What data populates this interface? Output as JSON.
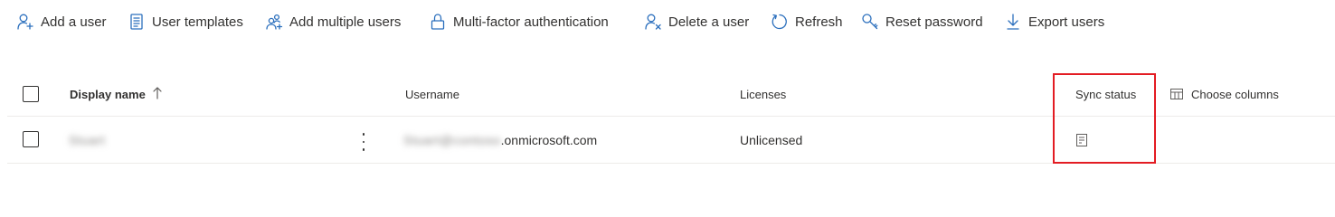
{
  "toolbar": {
    "items": [
      {
        "label": "Add a user",
        "icon": "person-add-icon"
      },
      {
        "label": "User templates",
        "icon": "document-list-icon"
      },
      {
        "label": "Add multiple users",
        "icon": "people-add-icon"
      },
      {
        "label": "Multi-factor authentication",
        "icon": "lock-icon"
      },
      {
        "label": "Delete a user",
        "icon": "person-delete-icon"
      },
      {
        "label": "Refresh",
        "icon": "refresh-icon"
      },
      {
        "label": "Reset password",
        "icon": "key-icon"
      },
      {
        "label": "Export users",
        "icon": "download-icon"
      }
    ]
  },
  "table": {
    "columns": {
      "display_name": "Display name",
      "username": "Username",
      "licenses": "Licenses",
      "sync_status": "Sync status",
      "choose_columns": "Choose columns"
    },
    "sort": {
      "column": "display_name",
      "direction": "ascending"
    },
    "rows": [
      {
        "display_name": "Stuart",
        "username_prefix": "Stuart@contoso",
        "username_domain": ".onmicrosoft.com",
        "licenses": "Unlicensed",
        "sync_status_icon": "cloud-sync-icon"
      }
    ]
  },
  "colors": {
    "accent": "#2b6fbd",
    "highlight_border": "#e31c23",
    "text": "#323130",
    "divider": "#edebe9"
  }
}
